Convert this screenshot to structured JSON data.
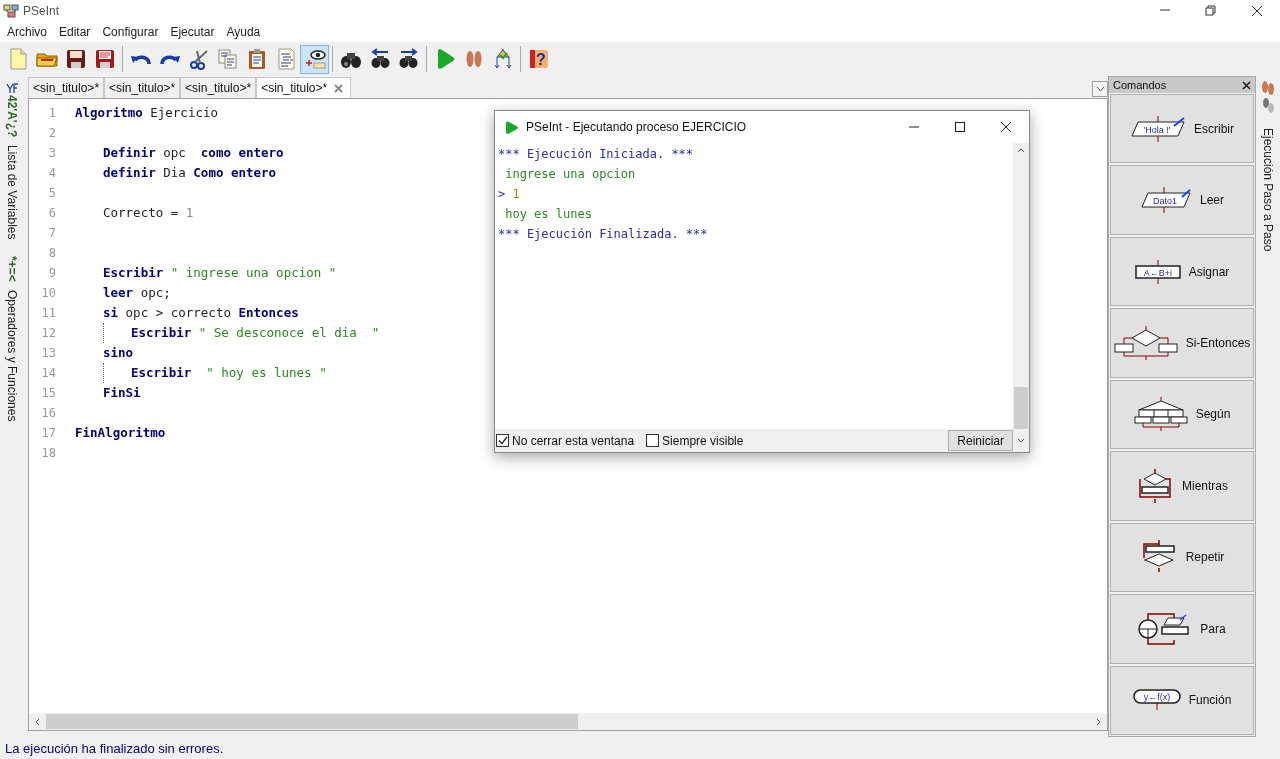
{
  "window": {
    "title": "PSeInt"
  },
  "menu": [
    "Archivo",
    "Editar",
    "Configurar",
    "Ejecutar",
    "Ayuda"
  ],
  "toolbar": [
    [
      {
        "kind": "new",
        "selected": false
      },
      {
        "kind": "open",
        "selected": false
      },
      {
        "kind": "save",
        "selected": false
      },
      {
        "kind": "save_as",
        "selected": false
      }
    ],
    [
      {
        "kind": "undo",
        "selected": false
      },
      {
        "kind": "redo",
        "selected": false
      },
      {
        "kind": "cut",
        "selected": false
      },
      {
        "kind": "copy",
        "selected": false
      },
      {
        "kind": "paste",
        "selected": false
      },
      {
        "kind": "indent",
        "selected": false
      },
      {
        "kind": "watch",
        "selected": true
      }
    ],
    [
      {
        "kind": "find",
        "selected": false
      },
      {
        "kind": "find_prev",
        "selected": false
      },
      {
        "kind": "find_next",
        "selected": false
      }
    ],
    [
      {
        "kind": "run",
        "selected": false
      },
      {
        "kind": "step",
        "selected": false
      },
      {
        "kind": "flowchart",
        "selected": false
      }
    ],
    [
      {
        "kind": "help",
        "glyph": "?",
        "selected": false
      }
    ]
  ],
  "left_sidebar": [
    {
      "glyph": "42'A'¿?",
      "label": "Lista de Variables"
    },
    {
      "glyph": "*+=<",
      "label": "Operadores y Funciones"
    }
  ],
  "tabs": [
    {
      "label": "<sin_titulo>*",
      "selected": false
    },
    {
      "label": "<sin_titulo>*",
      "selected": false
    },
    {
      "label": "<sin_titulo>*",
      "selected": false
    },
    {
      "label": "<sin_titulo>*",
      "selected": true
    }
  ],
  "editor": {
    "lines": [
      {
        "number": "1",
        "tokens": [
          {
            "kind": "keyword",
            "text": "Algoritmo"
          },
          {
            "kind": "plain",
            "text": " Ejercicio"
          }
        ],
        "children": [
          {
            "number": "2"
          },
          {
            "number": "3",
            "tokens": [
              {
                "kind": "keyword",
                "text": "Definir"
              },
              {
                "kind": "plain",
                "text": " opc  "
              },
              {
                "kind": "keyword",
                "text": "como entero"
              }
            ]
          },
          {
            "number": "4",
            "tokens": [
              {
                "kind": "keyword",
                "text": "definir"
              },
              {
                "kind": "plain",
                "text": " Dia "
              },
              {
                "kind": "keyword",
                "text": "Como entero"
              }
            ]
          },
          {
            "number": "5"
          },
          {
            "number": "6",
            "tokens": [
              {
                "kind": "plain",
                "text": "Correcto = "
              },
              {
                "kind": "number",
                "text": "1"
              }
            ]
          },
          {
            "number": "7"
          },
          {
            "number": "8"
          },
          {
            "number": "9",
            "tokens": [
              {
                "kind": "keyword",
                "text": "Escribir"
              },
              {
                "kind": "string",
                "text": " \" ingrese una opcion \""
              }
            ]
          },
          {
            "number": "10",
            "tokens": [
              {
                "kind": "keyword",
                "text": "leer"
              },
              {
                "kind": "plain",
                "text": " opc;"
              }
            ]
          },
          {
            "number": "11",
            "tokens": [
              {
                "kind": "keyword",
                "text": "si"
              },
              {
                "kind": "plain",
                "text": " opc > correcto "
              },
              {
                "kind": "keyword",
                "text": "Entonces"
              }
            ],
            "children": [
              {
                "number": "12",
                "tokens": [
                  {
                    "kind": "keyword",
                    "text": "Escribir"
                  },
                  {
                    "kind": "string",
                    "text": " \" Se desconoce el dia  \""
                  }
                ]
              }
            ]
          },
          {
            "number": "13",
            "tokens": [
              {
                "kind": "keyword",
                "text": "sino"
              }
            ],
            "children": [
              {
                "number": "14",
                "tokens": [
                  {
                    "kind": "keyword",
                    "text": "Escribir"
                  },
                  {
                    "kind": "string",
                    "text": "  \" hoy es lunes \""
                  }
                ]
              }
            ]
          },
          {
            "number": "15",
            "tokens": [
              {
                "kind": "keyword",
                "text": "FinSi"
              }
            ]
          },
          {
            "number": "16"
          }
        ]
      },
      {
        "number": "17",
        "tokens": [
          {
            "kind": "keyword",
            "text": "FinAlgoritmo"
          }
        ]
      },
      {
        "number": "18"
      }
    ]
  },
  "run_window": {
    "title": "PSeInt - Ejecutando proceso EJERCICIO",
    "output": [
      {
        "tokens": [
          {
            "kind": "info",
            "text": "*** Ejecución Iniciada. ***"
          }
        ]
      },
      {
        "tokens": [
          {
            "kind": "output",
            "text": " ingrese una opcion"
          }
        ]
      },
      {
        "tokens": [
          {
            "kind": "prompt",
            "text": "> "
          },
          {
            "kind": "input",
            "text": "1"
          }
        ]
      },
      {
        "tokens": [
          {
            "kind": "output",
            "text": " hoy es lunes"
          }
        ]
      },
      {
        "tokens": [
          {
            "kind": "info",
            "text": "*** Ejecución Finalizada. ***"
          }
        ]
      }
    ],
    "options": [
      {
        "label": "No cerrar esta ventana",
        "checked": true
      },
      {
        "label": "Siempre visible",
        "checked": false
      }
    ],
    "button": "Reiniciar"
  },
  "commands_panel": {
    "title": "Comandos",
    "items": [
      {
        "kind": "write",
        "label": "Escribir",
        "symbol_text": "'Hola !'"
      },
      {
        "kind": "read",
        "label": "Leer",
        "symbol_text": "Dato1"
      },
      {
        "kind": "assign",
        "label": "Asignar",
        "symbol_text": "A←B+i"
      },
      {
        "kind": "if",
        "label": "Si-Entonces"
      },
      {
        "kind": "switch",
        "label": "Según"
      },
      {
        "kind": "while",
        "label": "Mientras"
      },
      {
        "kind": "repeat",
        "label": "Repetir"
      },
      {
        "kind": "for",
        "label": "Para"
      },
      {
        "kind": "function",
        "label": "Función",
        "symbol_text": "y←f(x)"
      }
    ]
  },
  "right_strip": {
    "label": "Ejecución Paso a Paso"
  },
  "status_bar": "La ejecución ha finalizado sin errores."
}
